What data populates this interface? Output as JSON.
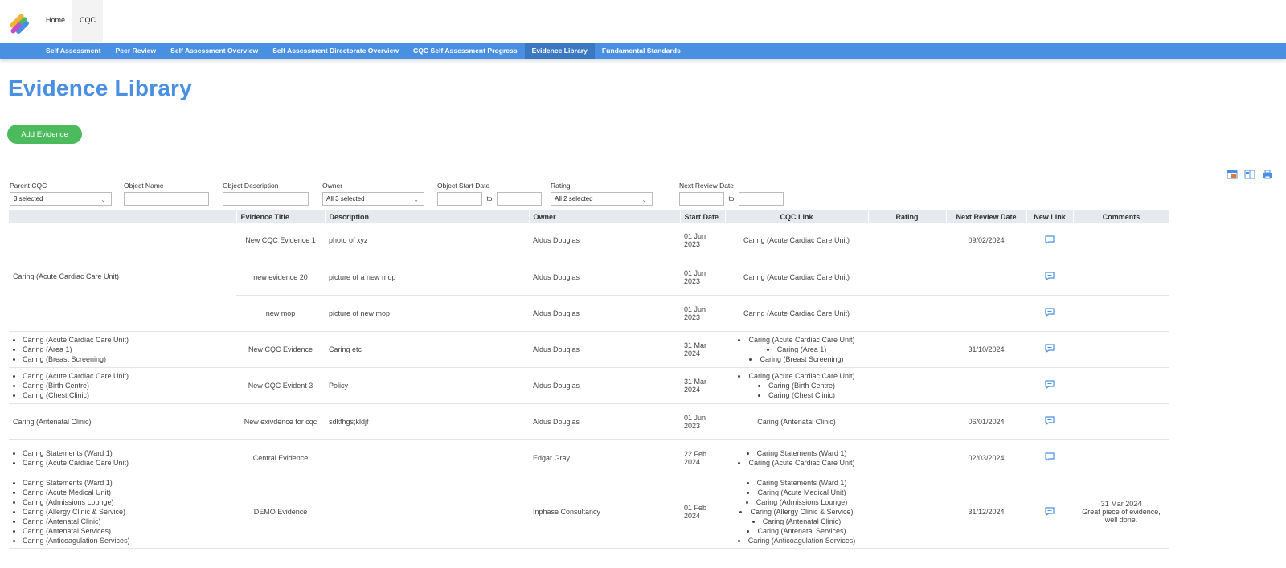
{
  "topnav": {
    "items": [
      {
        "label": "Home"
      },
      {
        "label": "CQC"
      }
    ]
  },
  "subnav": {
    "items": [
      {
        "label": "Self Assessment"
      },
      {
        "label": "Peer Review"
      },
      {
        "label": "Self Assessment Overview"
      },
      {
        "label": "Self Assessment Directorate Overview"
      },
      {
        "label": "CQC Self Assessment Progress"
      },
      {
        "label": "Evidence Library"
      },
      {
        "label": "Fundamental Standards"
      }
    ]
  },
  "page": {
    "title": "Evidence Library",
    "add_button": "Add Evidence"
  },
  "colors": {
    "accent": "#4a90e2",
    "add_button": "#4cbb5e"
  },
  "filters": {
    "parent_cqc": {
      "label": "Parent CQC",
      "value": "3 selected"
    },
    "object_name": {
      "label": "Object Name",
      "value": ""
    },
    "object_description": {
      "label": "Object Description",
      "value": ""
    },
    "owner": {
      "label": "Owner",
      "value": "All 3 selected"
    },
    "object_start_date": {
      "label": "Object Start Date",
      "to": "to",
      "from_value": "",
      "to_value": ""
    },
    "rating": {
      "label": "Rating",
      "value": "All 2 selected"
    },
    "next_review_date": {
      "label": "Next Review Date",
      "to": "to",
      "from_value": "",
      "to_value": ""
    }
  },
  "table": {
    "headers": {
      "evidence_title": "Evidence Title",
      "description": "Description",
      "owner": "Owner",
      "start_date": "Start Date",
      "cqc_link": "CQC Link",
      "rating": "Rating",
      "next_review_date": "Next Review Date",
      "new_link": "New Link",
      "comments": "Comments"
    },
    "group1": {
      "parent": "Caring (Acute Cardiac Care Unit)",
      "rows": [
        {
          "title": "New CQC Evidence 1",
          "description": "photo of xyz",
          "owner": "Aldus Douglas",
          "start": "01 Jun 2023",
          "cqc_link": "Caring (Acute Cardiac Care Unit)",
          "rating": "",
          "next_review": "09/02/2024",
          "comment": ""
        },
        {
          "title": "new evidence 20",
          "description": "picture of a new mop",
          "owner": "Aldus Douglas",
          "start": "01 Jun 2023",
          "cqc_link": "Caring (Acute Cardiac Care Unit)",
          "rating": "",
          "next_review": "",
          "comment": ""
        },
        {
          "title": "new mop",
          "description": "picture of new mop",
          "owner": "Aldus Douglas",
          "start": "01 Jun 2023",
          "cqc_link": "Caring (Acute Cardiac Care Unit)",
          "rating": "",
          "next_review": "",
          "comment": ""
        }
      ]
    },
    "row4": {
      "parents": [
        "Caring (Acute Cardiac Care Unit)",
        "Caring (Area 1)",
        "Caring (Breast Screening)"
      ],
      "title": "New CQC Evidence",
      "description": "Caring etc",
      "owner": "Aldus Douglas",
      "start": "31 Mar 2024",
      "cqc_links": [
        "Caring (Acute Cardiac Care Unit)",
        "Caring (Area 1)",
        "Caring (Breast Screening)"
      ],
      "next_review": "31/10/2024"
    },
    "row5": {
      "parents": [
        "Caring (Acute Cardiac Care Unit)",
        "Caring (Birth Centre)",
        "Caring (Chest Clinic)"
      ],
      "title": "New CQC Evident 3",
      "description": "Policy",
      "owner": "Aldus Douglas",
      "start": "31 Mar 2024",
      "cqc_links": [
        "Caring (Acute Cardiac Care Unit)",
        "Caring (Birth Centre)",
        "Caring (Chest Clinic)"
      ],
      "next_review": ""
    },
    "row6": {
      "parent": "Caring (Antenatal Clinic)",
      "title": "New exivdence for cqc",
      "description": "sdkfhgs;kldjf",
      "owner": "Aldus Douglas",
      "start": "01 Jun 2023",
      "cqc_link": "Caring (Antenatal Clinic)",
      "next_review": "06/01/2024"
    },
    "row7": {
      "parents": [
        "Caring Statements (Ward 1)",
        "Caring (Acute Cardiac Care Unit)"
      ],
      "title": "Central Evidence",
      "description": "",
      "owner": "Edgar Gray",
      "start": "22 Feb 2024",
      "cqc_links": [
        "Caring Statements (Ward 1)",
        "Caring (Acute Cardiac Care Unit)"
      ],
      "next_review": "02/03/2024"
    },
    "row8": {
      "parents": [
        "Caring Statements (Ward 1)",
        "Caring (Acute Medical Unit)",
        "Caring (Admissions Lounge)",
        "Caring (Allergy Clinic & Service)",
        "Caring (Antenatal Clinic)",
        "Caring (Antenatal Services)",
        "Caring (Anticoagulation Services)"
      ],
      "title": "DEMO Evidence",
      "description": "",
      "owner": "Inphase Consultancy",
      "start": "01 Feb 2024",
      "cqc_links": [
        "Caring Statements (Ward 1)",
        "Caring (Acute Medical Unit)",
        "Caring (Admissions Lounge)",
        "Caring (Allergy Clinic & Service)",
        "Caring (Antenatal Clinic)",
        "Caring (Antenatal Services)",
        "Caring (Anticoagulation Services)"
      ],
      "next_review": "31/12/2024",
      "comment_date": "31 Mar 2024",
      "comment_text": "Great piece of evidence, well done."
    }
  }
}
